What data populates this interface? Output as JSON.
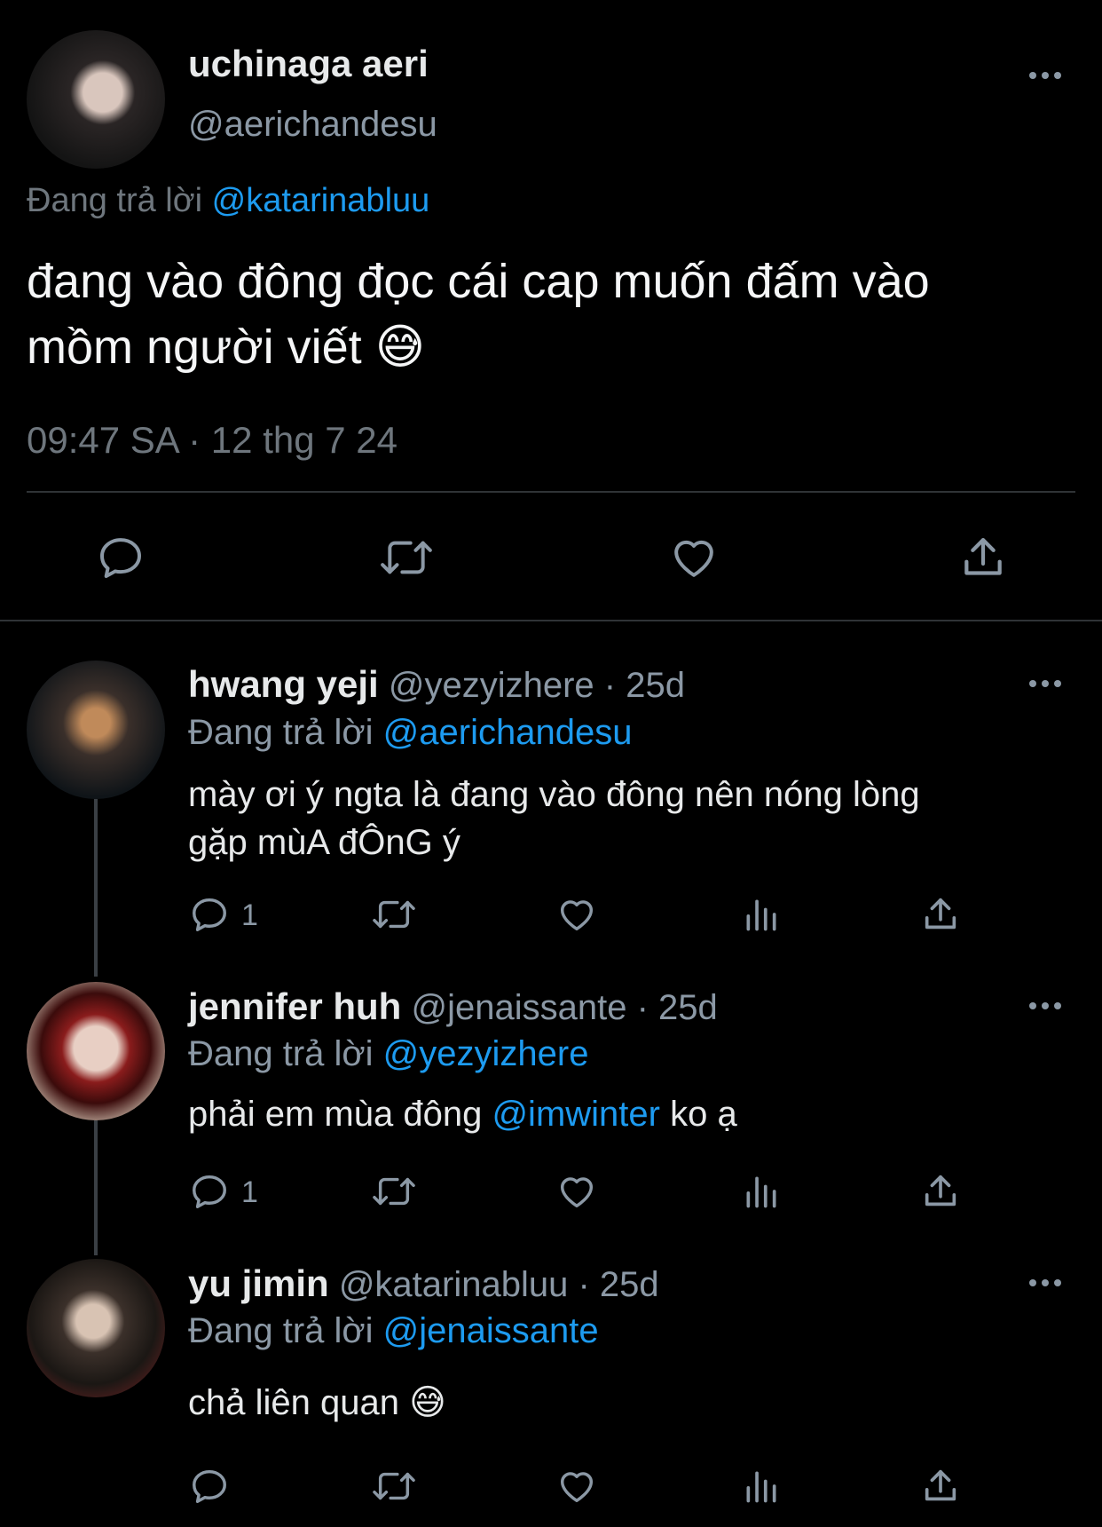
{
  "main_tweet": {
    "name": "uchinaga aeri",
    "handle": "@aerichandesu",
    "replying_prefix": "Đang trả lời",
    "replying_to": "@katarinabluu",
    "text_line1": "đang vào đông đọc cái cap muốn đấm vào",
    "text_line2": "mồm người viết",
    "emoji": "😅",
    "timestamp": "09:47 SA · 12 thg 7 24",
    "more_icon": "more-horizontal-icon"
  },
  "replies": [
    {
      "name": "hwang yeji",
      "handle": "@yezyizhere",
      "time": "· 25d",
      "replying_prefix": "Đang trả lời",
      "replying_to": "@aerichandesu",
      "text_line1": "mày ơi ý ngta là đang vào đông nên nóng lòng",
      "text_line2": "gặp mùA đÔnG ý",
      "reply_count": "1"
    },
    {
      "name": "jennifer huh",
      "handle": "@jenaissante",
      "time": "· 25d",
      "replying_prefix": "Đang trả lời",
      "replying_to": "@yezyizhere",
      "text_before": "phải em mùa đông",
      "mention": "@imwinter",
      "text_after": "ko ạ",
      "reply_count": "1"
    },
    {
      "name": "yu jimin",
      "handle": "@katarinabluu",
      "time": "· 25d",
      "replying_prefix": "Đang trả lời",
      "replying_to": "@jenaissante",
      "text": "chả liên quan",
      "emoji": "😅",
      "reply_count": ""
    }
  ],
  "colors": {
    "background": "#000000",
    "text": "#e7e9ea",
    "muted": "#6e767d",
    "link": "#1d9bf0",
    "divider": "#2f3336"
  }
}
